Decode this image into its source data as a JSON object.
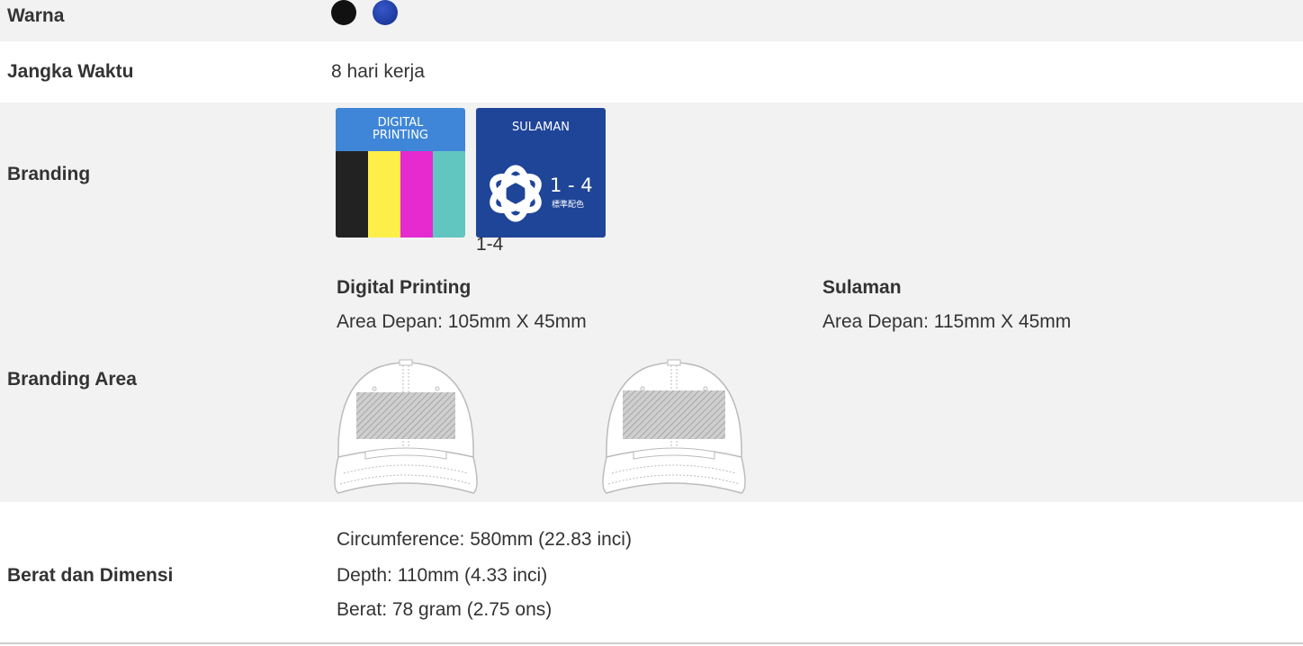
{
  "rows": {
    "warna": {
      "label": "Warna",
      "swatches": [
        {
          "name": "black",
          "color": "#111111"
        },
        {
          "name": "navy",
          "color": "#1e3a9e"
        }
      ]
    },
    "jangka_waktu": {
      "label": "Jangka Waktu",
      "value": "8 hari kerja"
    },
    "branding": {
      "label": "Branding",
      "digital_printing_badge": {
        "line1": "DIGITAL",
        "line2": "PRINTING",
        "colors": [
          "#222222",
          "#fdee4a",
          "#e52ad0",
          "#62c6c0"
        ],
        "header_color": "#3f86d8"
      },
      "sulaman_badge": {
        "title": "SULAMAN",
        "number": "1 - 4",
        "subtitle": "標準配色",
        "icon": "embroidery-flower-icon",
        "color": "#1f4598"
      },
      "caption": "1-4"
    },
    "branding_area": {
      "label": "Branding Area",
      "digital_printing": {
        "title": "Digital Printing",
        "area": "Area Depan: 105mm X 45mm"
      },
      "sulaman": {
        "title": "Sulaman",
        "area": "Area Depan: 115mm X 45mm"
      },
      "images": [
        "cap-front-digital-print-area",
        "cap-front-embroidery-area"
      ]
    },
    "berat_dimensi": {
      "label": "Berat dan Dimensi",
      "lines": [
        "Circumference: 580mm (22.83 inci)",
        "Depth: 110mm (4.33 inci)",
        "Berat: 78 gram (2.75 ons)"
      ]
    }
  }
}
